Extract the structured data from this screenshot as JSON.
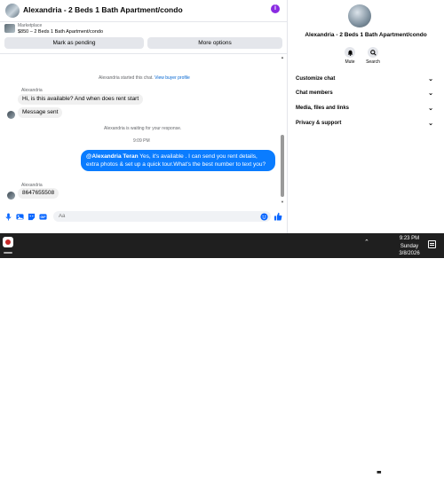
{
  "header": {
    "title": "Alexandria - 2 Beds 1 Bath Apartment/condo",
    "info_icon": "info-icon",
    "accent_color": "#8a2be2"
  },
  "marketplace": {
    "label": "Marketplace",
    "listing": "$850 – 2 Beds 1 Bath Apartment/condo"
  },
  "actions": {
    "pending_label": "Mark as pending",
    "more_label": "More options"
  },
  "thread": {
    "started_text": "Alexandria started this chat.",
    "view_profile": "View buyer profile",
    "buyer_name_1": "Alexandria",
    "msg_1": "Hi, is this available? And when does rent start",
    "msg_2": "Message sent",
    "waiting_text": "Alexandria is waiting for your response.",
    "time": "9:09 PM",
    "reply_mention": "@Alexandria Teran",
    "reply_text": " Yes, it's available .  I can send you rent details, extra photos & set up a quick tour.What's the best number to text you?",
    "buyer_name_2": "Alexandria",
    "msg_3": "8647655508",
    "outgoing_color": "#0a7cff"
  },
  "composer": {
    "placeholder": "Aa",
    "icons": [
      "mic-icon",
      "image-icon",
      "sticker-icon",
      "gif-icon",
      "emoji-icon",
      "like-icon"
    ]
  },
  "right_panel": {
    "title": "Alexandria - 2 Beds 1 Bath Apartment/condo",
    "mute_label": "Mute",
    "search_label": "Search",
    "sections": [
      {
        "label": "Customize chat"
      },
      {
        "label": "Chat members"
      },
      {
        "label": "Media, files and links"
      },
      {
        "label": "Privacy & support"
      }
    ]
  },
  "taskbar": {
    "time": "9:23 PM",
    "day": "Sunday",
    "date": "3/8/2026"
  }
}
